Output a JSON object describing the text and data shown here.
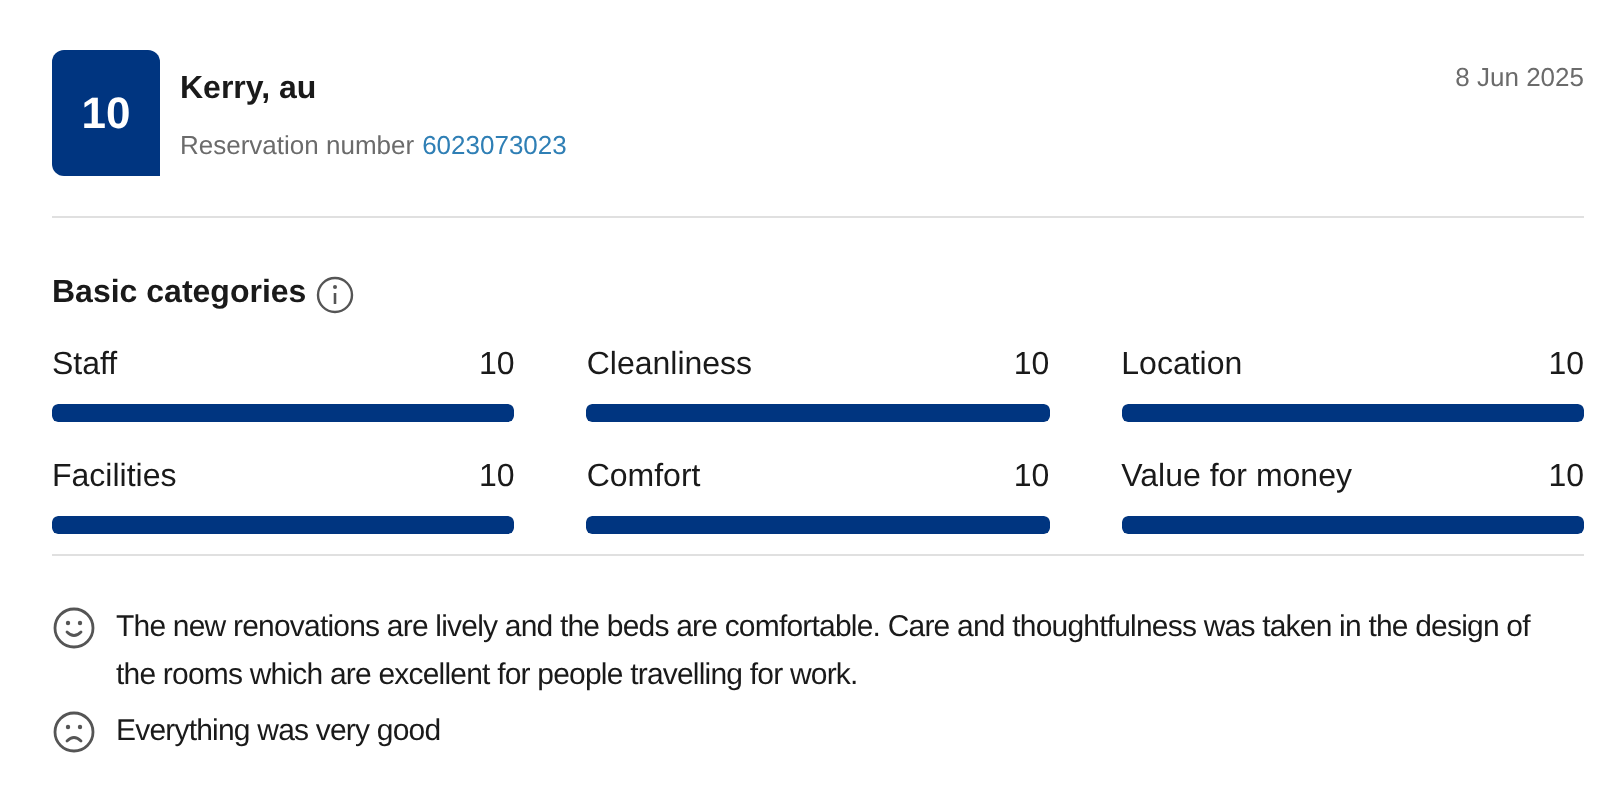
{
  "review": {
    "score": "10",
    "name": "Kerry, au",
    "reservation_label": "Reservation number",
    "reservation_number": "6023073023",
    "date": "8 Jun 2025"
  },
  "categories": {
    "title": "Basic categories",
    "items": [
      {
        "label": "Staff",
        "score": "10",
        "level": 1
      },
      {
        "label": "Cleanliness",
        "score": "10",
        "level": 1
      },
      {
        "label": "Location",
        "score": "10",
        "level": 1
      },
      {
        "label": "Facilities",
        "score": "10",
        "level": 1
      },
      {
        "label": "Comfort",
        "score": "10",
        "level": 1
      },
      {
        "label": "Value for money",
        "score": "10",
        "level": 1
      }
    ]
  },
  "comments": [
    {
      "kind": "positive",
      "text": "The new renovations are lively and the beds are comfortable. Care and thoughtfulness was taken in the design of the rooms which are excellent for people travelling for work."
    },
    {
      "kind": "negative",
      "text": "Everything was very good"
    }
  ]
}
